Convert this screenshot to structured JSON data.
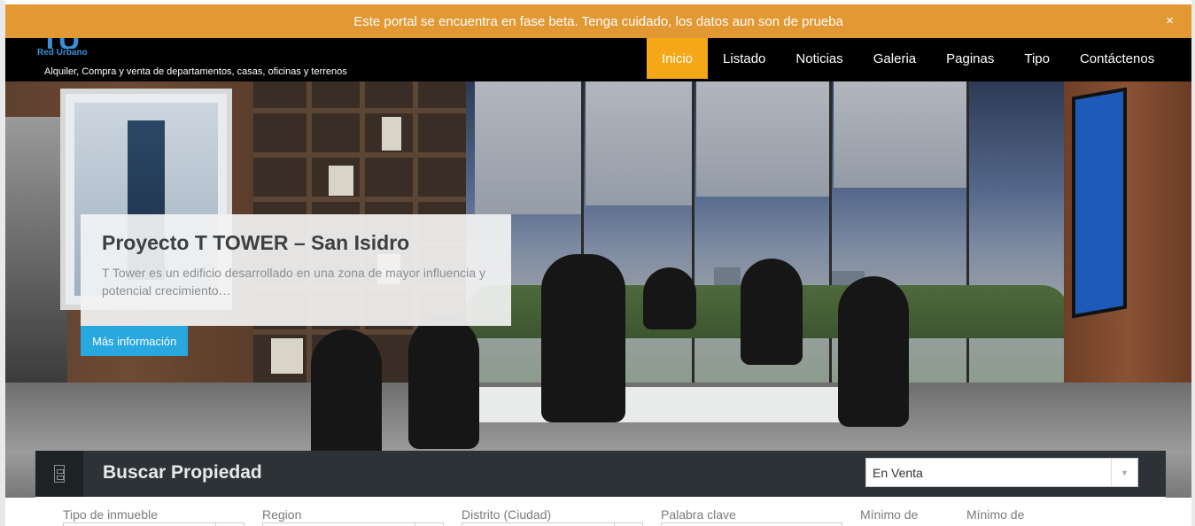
{
  "banner": {
    "text": "Este portal se encuentra en fase beta. Tenga cuidado, los datos aun son de prueba",
    "close_label": "×"
  },
  "header": {
    "logo_mark": "TU",
    "logo_name": "Red Urbano",
    "tagline": "Alquiler, Compra y venta de departamentos, casas, oficinas y terrenos",
    "nav": [
      {
        "label": "Inicio",
        "active": true
      },
      {
        "label": "Listado"
      },
      {
        "label": "Noticias"
      },
      {
        "label": "Galeria"
      },
      {
        "label": "Paginas"
      },
      {
        "label": "Tipo"
      },
      {
        "label": "Contáctenos"
      }
    ]
  },
  "hero": {
    "title": "Proyecto T TOWER – San Isidro",
    "description": "T Tower es un edificio desarrollado en una zona de mayor influencia y potencial crecimiento…",
    "button_label": "Más información"
  },
  "search": {
    "title": "Buscar Propiedad",
    "status_value": "En Venta",
    "filters": [
      {
        "label": "Tipo de inmueble"
      },
      {
        "label": "Region"
      },
      {
        "label": "Distrito (Ciudad)"
      },
      {
        "label": "Palabra clave"
      },
      {
        "label": "Mínimo de"
      },
      {
        "label": "Mínimo de"
      }
    ]
  },
  "colors": {
    "banner": "#e29833",
    "nav_active": "#f5a817",
    "button": "#29a8e0",
    "search_bar": "#2c3236"
  }
}
